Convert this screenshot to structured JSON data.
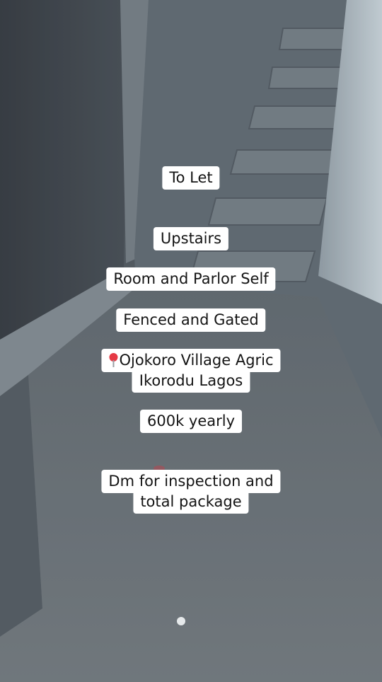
{
  "captions": {
    "to_let": "To Let",
    "upstairs": "Upstairs",
    "room_type": "Room and Parlor Self",
    "security": "Fenced and Gated",
    "location_icon": "round-pushpin-icon",
    "location_line1": "Ojokoro Village Agric",
    "location_line2": "Ikorodu Lagos",
    "price": "600k yearly",
    "contact_line1": "Dm for inspection and",
    "contact_line2": "total package"
  }
}
